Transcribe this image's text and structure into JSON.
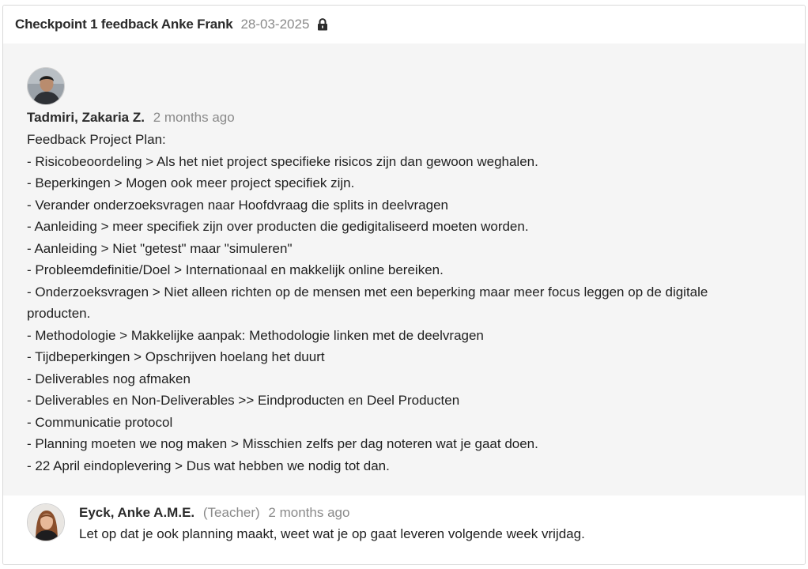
{
  "checkpoint": {
    "title": "Checkpoint 1  feedback Anke Frank",
    "date": "28-03-2025",
    "lock_icon": "lock-icon"
  },
  "post": {
    "author": "Tadmiri, Zakaria Z.",
    "time": "2 months ago",
    "lines": [
      "Feedback Project Plan:",
      "- Risicobeoordeling > Als het niet project specifieke risicos zijn dan gewoon weghalen.",
      "- Beperkingen > Mogen ook meer project specifiek zijn.",
      "- Verander onderzoeksvragen naar Hoofdvraag die splits in deelvragen",
      "- Aanleiding > meer specifiek zijn over producten die gedigitaliseerd moeten worden.",
      "- Aanleiding > Niet \"getest\" maar \"simuleren\"",
      "- Probleemdefinitie/Doel > Internationaal en makkelijk online bereiken.",
      "- Onderzoeksvragen > Niet alleen richten op de mensen met een beperking maar meer focus leggen op de digitale producten.",
      "- Methodologie > Makkelijke aanpak: Methodologie linken met de deelvragen",
      "- Tijdbeperkingen > Opschrijven hoelang het duurt",
      "- Deliverables nog afmaken",
      "- Deliverables en Non-Deliverables >> Eindproducten en Deel Producten",
      "- Communicatie protocol",
      "- Planning moeten we nog maken > Misschien zelfs per dag noteren wat je gaat doen.",
      "- 22 April eindoplevering > Dus wat hebben we nodig tot dan."
    ]
  },
  "reply": {
    "author": "Eyck, Anke A.M.E.",
    "role": "(Teacher)",
    "time": "2 months ago",
    "text": "Let op dat je ook planning maakt, weet wat je op gaat leveren volgende week vrijdag."
  }
}
